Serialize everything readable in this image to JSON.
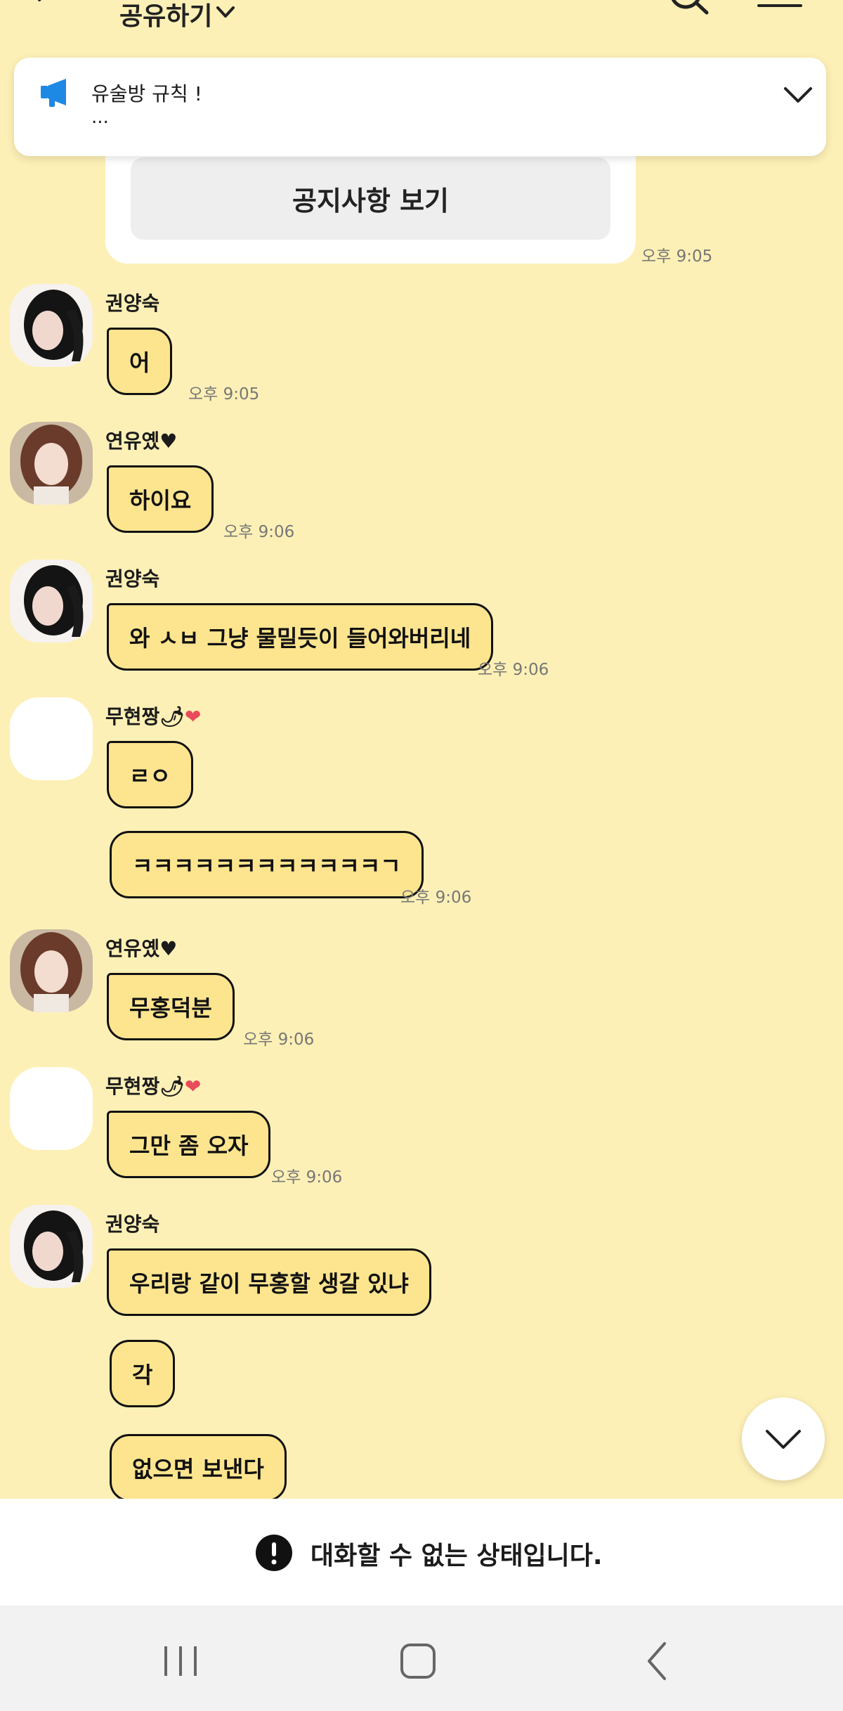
{
  "header": {
    "title": "공유하기",
    "back_icon": "back-arrow-icon",
    "dropdown_icon": "chevron-down-icon",
    "search_icon": "search-icon",
    "menu_icon": "menu-icon"
  },
  "notice_banner": {
    "title": "유술방 규칙 !",
    "subtitle": "...",
    "icon": "megaphone-icon",
    "expand_icon": "chevron-down-icon"
  },
  "notice_card": {
    "button_label": "공지사항 보기",
    "time": "오후 9:05"
  },
  "messages": [
    {
      "sender": "권양숙",
      "avatar": "avatar-dark-hair",
      "bubbles": [
        "어"
      ],
      "time": "오후 9:05"
    },
    {
      "sender": "연유옜",
      "sender_suffix": "♥",
      "avatar": "avatar-brown-hair",
      "bubbles": [
        "하이요"
      ],
      "time": "오후 9:06"
    },
    {
      "sender": "권양숙",
      "avatar": "avatar-dark-hair",
      "bubbles": [
        "와 ㅅㅂ 그냥 물밀듯이 들어와버리네"
      ],
      "time": "오후 9:06"
    },
    {
      "sender": "무현짱",
      "sender_emoji": "🌶",
      "sender_suffix": "❤",
      "avatar": "avatar-blank",
      "bubbles": [
        "ㄹㅇ",
        "ㅋㅋㅋㅋㅋㅋㅋㅋㅋㅋㅋㅋㄱ"
      ],
      "time": "오후 9:06"
    },
    {
      "sender": "연유옜",
      "sender_suffix": "♥",
      "avatar": "avatar-brown-hair",
      "bubbles": [
        "무홍덕분"
      ],
      "time": "오후 9:06"
    },
    {
      "sender": "무현짱",
      "sender_emoji": "🌶",
      "sender_suffix": "❤",
      "avatar": "avatar-blank",
      "bubbles": [
        "그만 좀 오자"
      ],
      "time": "오후 9:06"
    },
    {
      "sender": "권양숙",
      "avatar": "avatar-dark-hair",
      "bubbles": [
        "우리랑 같이 무홍할 생갈 있냐",
        "각",
        "없으면 보낸다"
      ]
    }
  ],
  "scroll_button": {
    "icon": "chevron-down-icon"
  },
  "status_bar": {
    "text": "대화할 수 없는 상태입니다.",
    "icon": "alert-icon"
  },
  "nav_bar": {
    "recents_icon": "recents-icon",
    "home_icon": "home-icon",
    "back_icon": "back-icon"
  },
  "colors": {
    "background": "#fdf0b6",
    "bubble": "#fde58f",
    "notice_icon": "#1e88e5"
  }
}
